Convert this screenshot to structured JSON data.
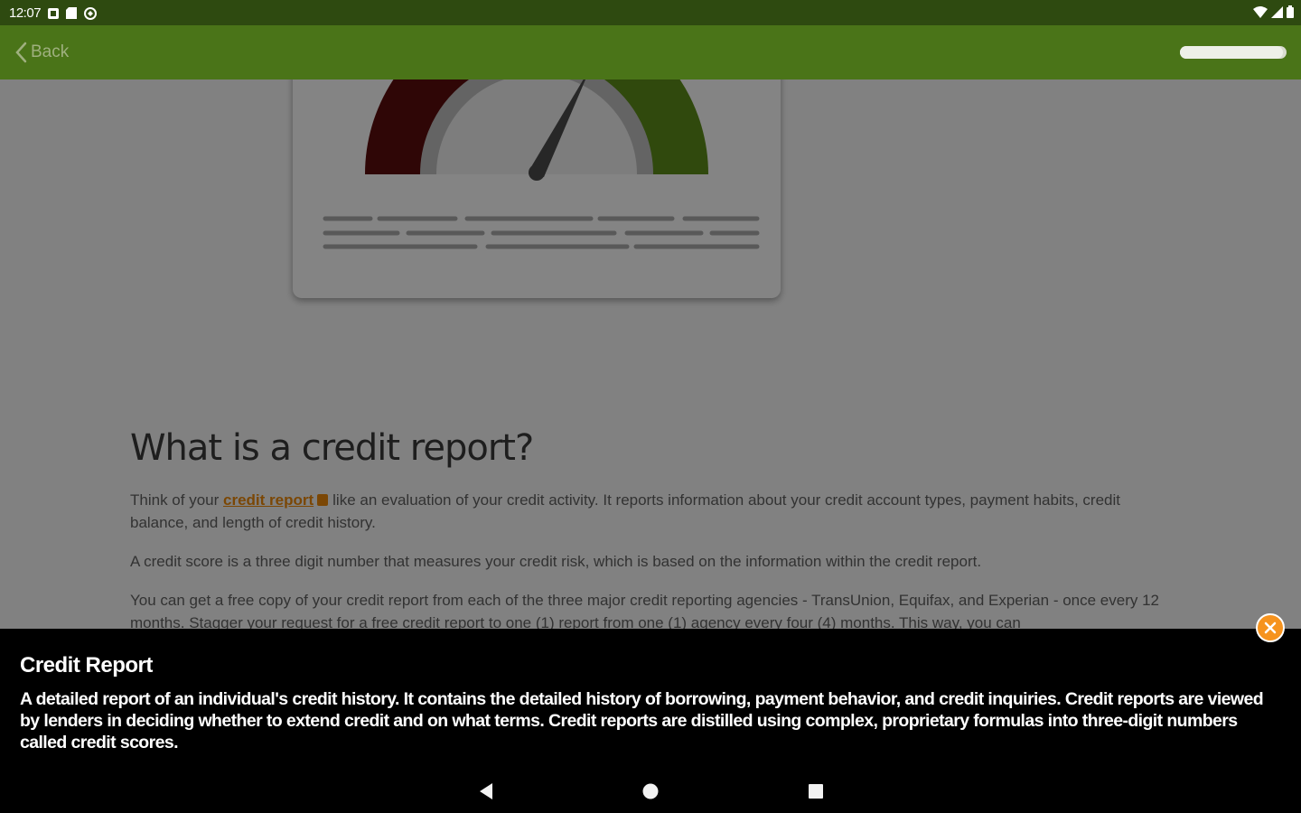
{
  "status_bar": {
    "time": "12:07",
    "left_icons": [
      "notification-icon",
      "sd-card-icon",
      "sync-icon"
    ],
    "right_icons": [
      "wifi-icon",
      "signal-icon",
      "battery-icon"
    ]
  },
  "app_bar": {
    "back_label": "Back",
    "background_color": "#4a7418",
    "progress_fraction": 0.97
  },
  "illustration": {
    "type": "credit-score-gauge",
    "segment_colors": [
      "#5a0c0c",
      "#e8870b",
      "#5c8a1a"
    ]
  },
  "article": {
    "title": "What is a credit report?",
    "p1_prefix": "Think of your",
    "p1_link": "credit report",
    "p1_suffix": "like an evaluation of your credit activity. It reports information about your credit account types, payment habits, credit balance, and length of credit history.",
    "p2": "A credit score is a three digit number that measures your credit risk, which is based on the information within the credit report.",
    "p3": "You can get a free copy of your credit report from each of the three major credit reporting agencies - TransUnion, Equifax, and Experian - once every 12 months. Stagger your request for a free credit report to one (1) report from one (1) agency every four (4) months. This way, you can"
  },
  "popup": {
    "title": "Credit Report",
    "body": "A detailed report of an individual's credit history. It contains the detailed history of borrowing, payment behavior, and credit inquiries. Credit reports are viewed by lenders in deciding whether to extend credit and on what terms. Credit reports are distilled using complex, proprietary formulas into three-digit numbers called credit scores.",
    "accent_color": "#f6931e"
  },
  "nav_bar": {
    "buttons": [
      "back-nav-icon",
      "home-nav-icon",
      "recents-nav-icon"
    ]
  }
}
